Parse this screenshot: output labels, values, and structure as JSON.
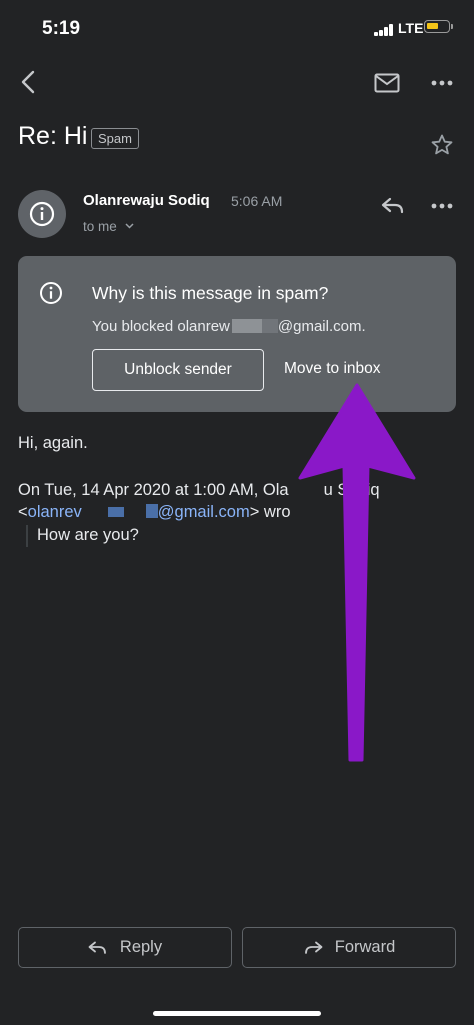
{
  "status_bar": {
    "time": "5:19",
    "network": "LTE"
  },
  "toolbar": {
    "back_icon": "chevron-left-icon",
    "mail_icon": "envelope-icon",
    "more_icon": "more-horizontal-icon"
  },
  "email": {
    "subject": "Re: Hi",
    "label": "Spam",
    "sender": "Olanrewaju Sodiq",
    "time": "5:06 AM",
    "recipient": "to me",
    "star_icon": "star-outline-icon"
  },
  "spam_notice": {
    "title": "Why is this message in spam?",
    "reason_prefix": "You blocked olanrew",
    "reason_suffix": "@gmail.com.",
    "unblock_label": "Unblock sender",
    "move_label": "Move to inbox"
  },
  "message": {
    "greeting": "Hi, again.",
    "quote_header_line1": "On Tue, 14 Apr 2020 at 1:00 AM, Ola",
    "quote_header_line1_tail": "u Sodiq",
    "quote_open": "<",
    "quote_email_prefix": "olanrev",
    "quote_email_suffix": "@gmail.com",
    "quote_after_email": "> wro",
    "quoted_text": "How are you?"
  },
  "footer": {
    "reply_label": "Reply",
    "forward_label": "Forward"
  },
  "colors": {
    "background": "#222325",
    "card": "#5e6266",
    "link": "#8ab4f8",
    "arrow": "#8a18c8"
  }
}
